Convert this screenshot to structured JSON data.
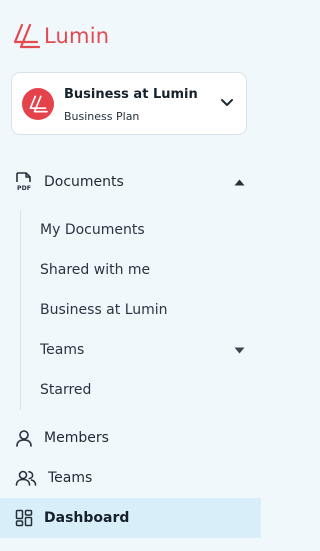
{
  "brand": {
    "name": "Lumin",
    "color": "#e34a4f"
  },
  "workspace": {
    "name": "Business at Lumin",
    "plan": "Business Plan",
    "avatar_color": "#e5434b",
    "chevron_icon": "chevron-down-icon"
  },
  "nav": {
    "documents": {
      "label": "Documents",
      "icon": "pdf-file-icon",
      "expanded": true,
      "children": [
        {
          "label": "My Documents"
        },
        {
          "label": "Shared with me"
        },
        {
          "label": "Business at Lumin"
        },
        {
          "label": "Teams",
          "has_submenu": true
        },
        {
          "label": "Starred"
        }
      ]
    },
    "members": {
      "label": "Members",
      "icon": "user-icon"
    },
    "teams": {
      "label": "Teams",
      "icon": "users-icon"
    },
    "dashboard": {
      "label": "Dashboard",
      "icon": "dashboard-icon",
      "active": true
    }
  },
  "colors": {
    "sidebar_bg": "#f1f8fc",
    "active_bg": "#d8eef8",
    "text": "#1f2933"
  }
}
